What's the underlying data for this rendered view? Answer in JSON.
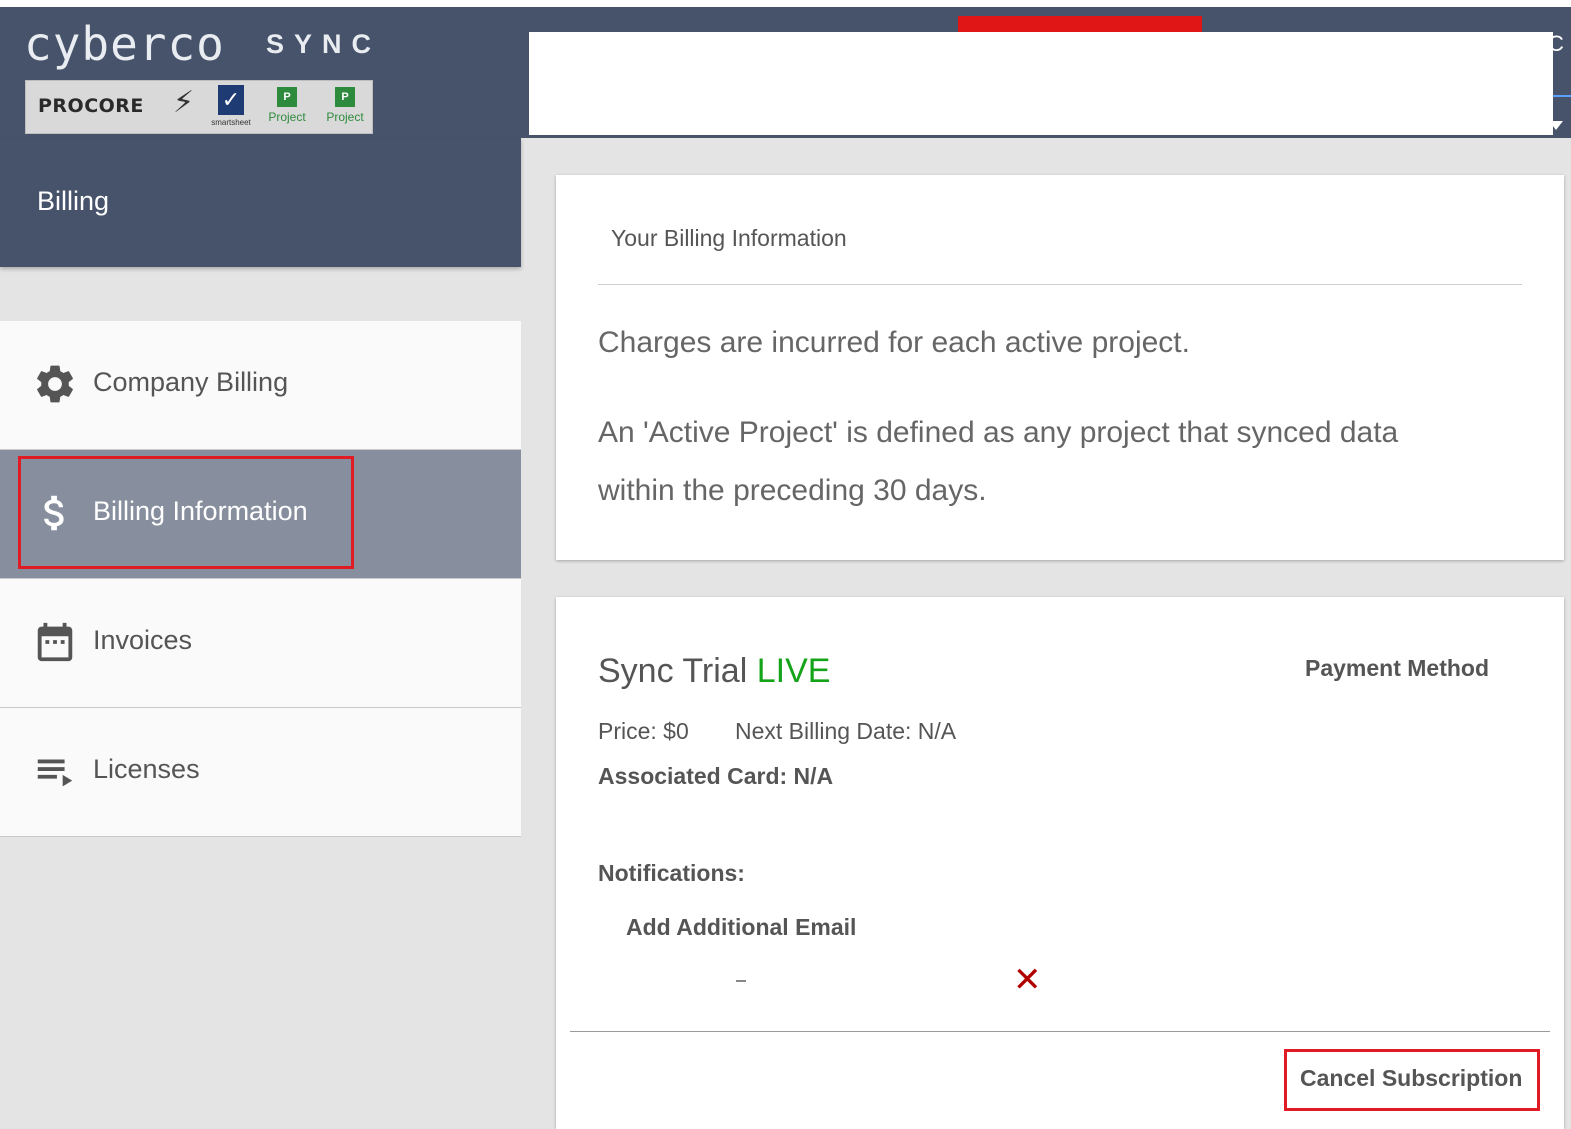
{
  "header": {
    "logo_text": "cyberco",
    "logo_sub": "SYNC",
    "partners": {
      "procore": "PROCORE",
      "smartsheet": "smartsheet",
      "project_desktop": "Project",
      "project_online": "Project"
    },
    "fragment_right": "C"
  },
  "sidebar": {
    "title": "Billing",
    "items": [
      {
        "label": "Company Billing",
        "icon": "gear-icon"
      },
      {
        "label": "Billing Information",
        "icon": "dollar-icon",
        "active": true
      },
      {
        "label": "Invoices",
        "icon": "calendar-icon"
      },
      {
        "label": "Licenses",
        "icon": "playlist-icon"
      }
    ]
  },
  "billing_info": {
    "title": "Your Billing Information",
    "line1": "Charges are incurred for each active project.",
    "line2": "An 'Active Project' is defined as any project that synced data",
    "line3": "within the preceding 30 days."
  },
  "subscription": {
    "plan": "Sync Trial",
    "status": "LIVE",
    "payment_method_label": "Payment Method",
    "price": "Price: $0",
    "next_billing": "Next Billing Date: N/A",
    "associated_card": "Associated Card: N/A",
    "notifications_label": "Notifications:",
    "add_email_label": "Add Additional Email",
    "remove_symbol": "✕",
    "cancel_label": "Cancel Subscription"
  },
  "colors": {
    "header_bg": "#46536a",
    "active_item_bg": "#878f9e",
    "live_green": "#15a31a",
    "highlight_red": "#e01b24",
    "remove_red": "#b00000"
  }
}
